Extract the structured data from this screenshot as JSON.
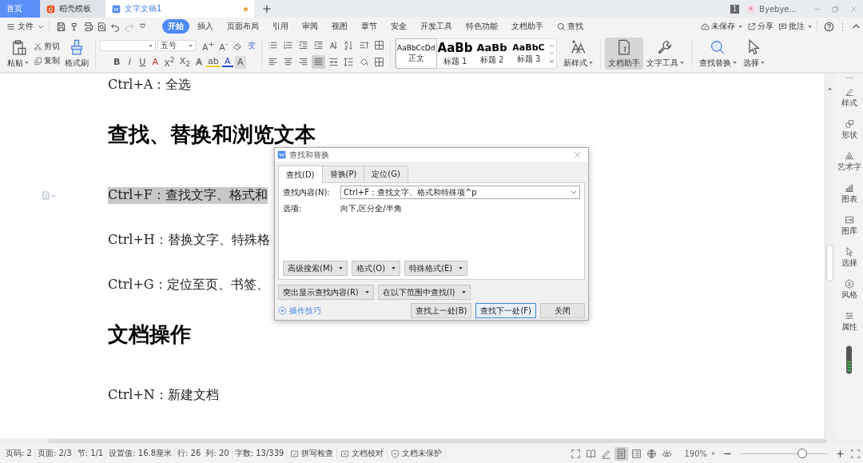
{
  "tabs": [
    {
      "label": "首页",
      "kind": "home",
      "selected": false,
      "unsaved": false
    },
    {
      "label": "稻壳模板",
      "kind": "template",
      "selected": false,
      "unsaved": false
    },
    {
      "label": "文字文稿1",
      "kind": "doc",
      "selected": true,
      "unsaved": true
    }
  ],
  "account": {
    "count": "1",
    "name": "Byebye..."
  },
  "menu": {
    "file": "文件",
    "search": "查找",
    "tabs": [
      {
        "label": "开始",
        "selected": true
      },
      {
        "label": "插入",
        "selected": false
      },
      {
        "label": "页面布局",
        "selected": false
      },
      {
        "label": "引用",
        "selected": false
      },
      {
        "label": "审阅",
        "selected": false
      },
      {
        "label": "视图",
        "selected": false
      },
      {
        "label": "章节",
        "selected": false
      },
      {
        "label": "安全",
        "selected": false
      },
      {
        "label": "开发工具",
        "selected": false
      },
      {
        "label": "特色功能",
        "selected": false
      },
      {
        "label": "文档助手",
        "selected": false
      }
    ],
    "actions": [
      {
        "label": "未保存",
        "kind": "cloud",
        "dropdown": true
      },
      {
        "label": "分享",
        "kind": "share",
        "dropdown": false
      },
      {
        "label": "批注",
        "kind": "comment",
        "dropdown": true
      }
    ]
  },
  "ribbon": {
    "paste": "粘贴",
    "cut": "剪切",
    "copy": "复制",
    "painter": "格式刷",
    "font_size": "五号",
    "size_buttons": [
      "A$^{+}$",
      "A$^{-}$"
    ],
    "phonetic": "变",
    "font_buttons": [
      {
        "text": "B",
        "kind": "bold"
      },
      {
        "text": "I",
        "kind": "italic"
      },
      {
        "text": "U",
        "kind": "underline"
      },
      {
        "text": "A",
        "kind": "strike"
      },
      {
        "text": "X$^{2}$",
        "kind": "plain"
      },
      {
        "text": "X$_{2}$",
        "kind": "plain"
      },
      {
        "text": "A",
        "kind": "outline"
      },
      {
        "text": "ab",
        "kind": "highlight"
      },
      {
        "text": "A",
        "kind": "color"
      },
      {
        "text": "A",
        "kind": "shade"
      }
    ],
    "alignment_buttons": [
      {
        "kind": "left",
        "selected": false
      },
      {
        "kind": "center",
        "selected": false
      },
      {
        "kind": "right",
        "selected": false
      },
      {
        "kind": "justify",
        "selected": true
      },
      {
        "kind": "distribute",
        "selected": false
      }
    ],
    "styles": [
      {
        "preview": "AaBbCcDd",
        "label": "正文",
        "kind": "body"
      },
      {
        "preview": "AaBb",
        "label": "标题 1",
        "kind": "h1"
      },
      {
        "preview": "AaBb",
        "label": "标题 2",
        "kind": "h2"
      },
      {
        "preview": "AaBbC",
        "label": "标题 3",
        "kind": "h3"
      }
    ],
    "new_style": "新样式",
    "tools": [
      {
        "label": "文档助手",
        "kind": "assistant",
        "selected": true,
        "dropdown": false
      },
      {
        "label": "文字工具",
        "kind": "wrench",
        "selected": false,
        "dropdown": true
      },
      {
        "label": "查找替换",
        "kind": "search",
        "selected": false,
        "dropdown": true
      },
      {
        "label": "选择",
        "kind": "cursor",
        "selected": false,
        "dropdown": true
      }
    ]
  },
  "document": {
    "blocks": [
      {
        "kind": "line",
        "text": "Ctrl+A：全选",
        "highlighted": false,
        "paragraph_mark": false
      },
      {
        "kind": "heading",
        "text": "查找、替换和浏览文本",
        "highlighted": false,
        "paragraph_mark": false
      },
      {
        "kind": "line",
        "text": "Ctrl+F：查找文字、格式和",
        "highlighted": true,
        "paragraph_mark": true
      },
      {
        "kind": "line",
        "text": "Ctrl+H：替换文字、特殊格",
        "highlighted": false,
        "paragraph_mark": false
      },
      {
        "kind": "line",
        "text": "Ctrl+G：定位至页、书签、",
        "highlighted": false,
        "paragraph_mark": false
      },
      {
        "kind": "heading",
        "text": "文档操作",
        "highlighted": false,
        "paragraph_mark": false
      },
      {
        "kind": "line",
        "text": "Ctrl+N：新建文档",
        "highlighted": false,
        "paragraph_mark": false
      }
    ]
  },
  "dialog": {
    "title": "查找和替换",
    "tabs": [
      {
        "label": "查找(D)",
        "selected": true
      },
      {
        "label": "替换(P)",
        "selected": false
      },
      {
        "label": "定位(G)",
        "selected": false
      }
    ],
    "find_label": "查找内容(N):",
    "find_value": "Ctrl+F：查找文字、格式和特殊项^p",
    "options_label": "选项:",
    "options_value": "向下,区分全/半角",
    "panel_buttons": [
      "高级搜索(M)",
      "格式(O)",
      "特殊格式(E)"
    ],
    "scope_buttons": [
      "突出显示查找内容(R)",
      "在以下范围中查找(I)"
    ],
    "tips": "操作技巧",
    "actions": [
      {
        "label": "查找上一处(B)",
        "default": false
      },
      {
        "label": "查找下一处(F)",
        "default": true
      },
      {
        "label": "关闭",
        "default": false
      }
    ]
  },
  "sidebar": {
    "items": [
      {
        "label": "样式",
        "kind": "style"
      },
      {
        "label": "形状",
        "kind": "shape"
      },
      {
        "label": "艺术字",
        "kind": "art"
      },
      {
        "label": "图表",
        "kind": "chart"
      },
      {
        "label": "图库",
        "kind": "gallery"
      },
      {
        "label": "选择",
        "kind": "cursor"
      },
      {
        "label": "风格",
        "kind": "theme"
      },
      {
        "label": "属性",
        "kind": "props"
      }
    ]
  },
  "status_bar": {
    "items": [
      "页码: 2",
      "页面: 2/3",
      "节: 1/1",
      "设置值: 16.8厘米",
      "行: 26",
      "列: 20",
      "字数: 13/339"
    ],
    "tools": [
      {
        "label": "拼写检查",
        "kind": "spell"
      },
      {
        "label": "文档校对",
        "kind": "proof"
      },
      {
        "label": "文档未保护",
        "kind": "shield"
      }
    ],
    "views": [
      {
        "kind": "fullscreen",
        "selected": false
      },
      {
        "kind": "book",
        "selected": false
      },
      {
        "kind": "pen",
        "selected": false
      },
      {
        "kind": "page",
        "selected": true
      },
      {
        "kind": "outline",
        "selected": false
      },
      {
        "kind": "web",
        "selected": false
      },
      {
        "kind": "eye",
        "selected": false
      }
    ],
    "zoom": "190%",
    "zoom_slider": {
      "level": 0.71
    }
  }
}
